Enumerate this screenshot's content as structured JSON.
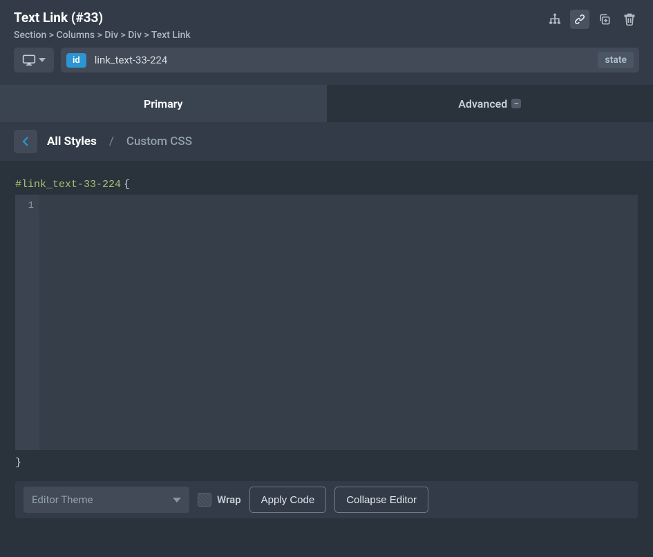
{
  "header": {
    "title": "Text Link (#33)",
    "breadcrumb": [
      "Section",
      "Columns",
      "Div",
      "Div",
      "Text Link"
    ]
  },
  "id_row": {
    "badge": "id",
    "value": "link_text-33-224",
    "state_label": "state"
  },
  "tabs": {
    "primary": "Primary",
    "advanced": "Advanced",
    "advanced_indicator": "–"
  },
  "subnav": {
    "root": "All Styles",
    "current": "Custom CSS"
  },
  "editor": {
    "selector": "#link_text-33-224",
    "open_brace": "{",
    "close_brace": "}",
    "gutter_lines": [
      "1"
    ],
    "content": ""
  },
  "footer": {
    "theme_placeholder": "Editor Theme",
    "wrap_label": "Wrap",
    "apply_label": "Apply Code",
    "collapse_label": "Collapse Editor"
  }
}
